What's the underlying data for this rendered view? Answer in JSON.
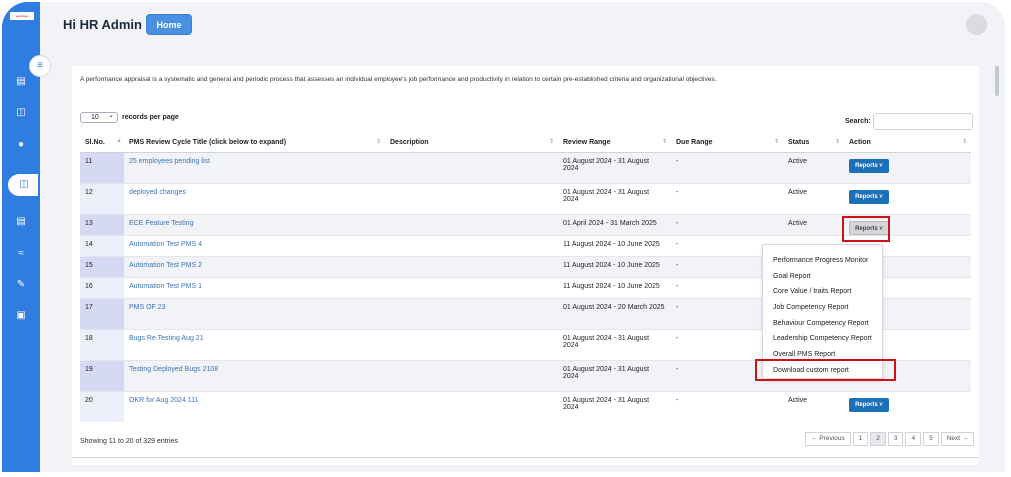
{
  "app": {
    "logo_text": "yourlogo"
  },
  "header": {
    "greeting": "Hi HR Admin",
    "home_label": "Home"
  },
  "intro_text": "A performance appraisal is a systematic and general and periodic process that assesses an individual employee's job performance and productivity in relation to certain pre-established criteria and organizational objectives.",
  "controls": {
    "length_value": "10",
    "length_label": "records per page",
    "search_label": "Search:"
  },
  "table": {
    "columns": [
      "Sl.No.",
      "PMS Review Cycle Title (click below to expand)",
      "Description",
      "Review Range",
      "Due Range",
      "Status",
      "Action"
    ],
    "rows": [
      {
        "sl": "11",
        "title": "25 employees pending list",
        "desc": "",
        "review": "01 August 2024 - 31 August 2024",
        "due": "-",
        "status": "Active",
        "action": "Reports"
      },
      {
        "sl": "12",
        "title": "deployed changes",
        "desc": "",
        "review": "01 August 2024 - 31 August 2024",
        "due": "-",
        "status": "Active",
        "action": "Reports"
      },
      {
        "sl": "13",
        "title": "ECE Feature Testing",
        "desc": "",
        "review": "01 April 2024 - 31 March 2025",
        "due": "-",
        "status": "Active",
        "action": "Reports"
      },
      {
        "sl": "14",
        "title": "Automation Test PMS 4",
        "desc": "",
        "review": "11 August 2024 - 10 June 2025",
        "due": "-",
        "status": "",
        "action": ""
      },
      {
        "sl": "15",
        "title": "Automation Test PMS 2",
        "desc": "",
        "review": "11 August 2024 - 10 June 2025",
        "due": "-",
        "status": "",
        "action": ""
      },
      {
        "sl": "16",
        "title": "Automation Test PMS 1",
        "desc": "",
        "review": "11 August 2024 - 10 June 2025",
        "due": "-",
        "status": "",
        "action": ""
      },
      {
        "sl": "17",
        "title": "PMS OF 23",
        "desc": "",
        "review": "01 August 2024 - 20 March 2025",
        "due": "-",
        "status": "",
        "action": ""
      },
      {
        "sl": "18",
        "title": "Bugs Re Testing Aug 21",
        "desc": "",
        "review": "01 August 2024 - 31 August 2024",
        "due": "-",
        "status": "",
        "action": ""
      },
      {
        "sl": "19",
        "title": "Testing Deployed Bugs 2108",
        "desc": "",
        "review": "01 August 2024 - 31 August 2024",
        "due": "-",
        "status": "",
        "action": ""
      },
      {
        "sl": "20",
        "title": "OKR for Aug 2024 111",
        "desc": "",
        "review": "01 August 2024 - 31 August 2024",
        "due": "-",
        "status": "Active",
        "action": "Reports"
      }
    ]
  },
  "dropdown": {
    "items": [
      "Performance Progress Monitor",
      "Goal Report",
      "Core Value / traits Report",
      "Job Competency Report",
      "Behaviour Competency Report",
      "Leadership Competency Report",
      "Overall PMS Report",
      "Download custom report"
    ]
  },
  "footer": {
    "info": "Showing 11 to 20 of 329 entries",
    "pager": [
      "← Previous",
      "1",
      "2",
      "3",
      "4",
      "5",
      "Next →"
    ]
  },
  "colors": {
    "sidebar": "#2f7de1",
    "button": "#1c6fb9",
    "highlight": "#d01018"
  }
}
